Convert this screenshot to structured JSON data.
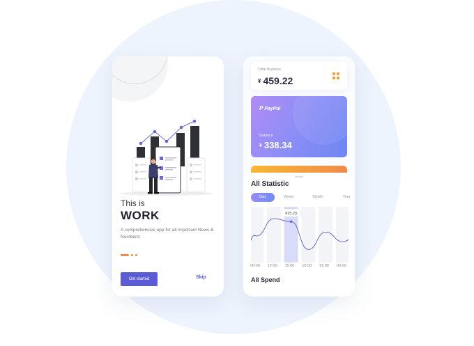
{
  "onboarding": {
    "headline_small": "This is",
    "headline_big": "WORK",
    "description": "A comprehensive app for all important News & Numbers!",
    "get_started_label": "Get started",
    "skip_label": "Skip",
    "pager": {
      "current": 1,
      "total": 3
    },
    "accent_color": "#5b5bd6",
    "dot_color": "#f08a4b"
  },
  "wallet": {
    "total_balance": {
      "label": "Total Balance",
      "currency": "¥",
      "value": "459.22",
      "icon": "grid-menu-icon"
    },
    "paypal_card": {
      "brand": "PayPal",
      "brand_icon": "paypal-icon",
      "label": "Balance",
      "currency": "¥",
      "value": "338.34"
    },
    "statistic": {
      "title": "All Statistic",
      "tabs": [
        "Day",
        "Week",
        "Month",
        "Year"
      ],
      "selected_tab": "Day",
      "tooltip": "¥15.23",
      "x_labels": [
        "00:00",
        "12:00",
        "15:00",
        "18:00",
        "21:00",
        "00:00"
      ],
      "highlight_label": "15:00"
    },
    "spend_title": "All Spend",
    "colors": {
      "card_start": "#b28bf5",
      "card_end": "#6d86f3",
      "orange_start": "#f7b733",
      "orange_end": "#f08a4b",
      "line": "#6b6bd2"
    }
  },
  "chart_data": {
    "type": "line",
    "categories": [
      "00:00",
      "12:00",
      "15:00",
      "18:00",
      "21:00",
      "00:00"
    ],
    "series": [
      {
        "values": [
          11.5,
          16.0,
          15.23,
          8.0,
          12.5,
          10.0
        ]
      }
    ],
    "highlight": {
      "x": "15:00",
      "y": 15.23,
      "label": "¥15.23"
    }
  }
}
